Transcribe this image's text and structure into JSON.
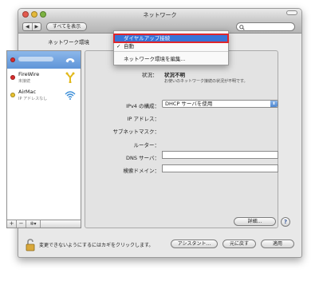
{
  "window": {
    "title": "ネットワーク"
  },
  "toolbar": {
    "back_label": "◀",
    "forward_label": "▶",
    "show_all_label": "すべてを表示",
    "search_placeholder": ""
  },
  "location": {
    "label": "ネットワーク環境"
  },
  "location_menu": {
    "items": [
      {
        "label": "ダイヤルアップ接続",
        "highlighted": true,
        "checked": false
      },
      {
        "label": "自動",
        "highlighted": false,
        "checked": true
      },
      {
        "label": "ネットワーク環境を編集...",
        "highlighted": false,
        "checked": false
      }
    ],
    "check_mark": "✓"
  },
  "sidebar": {
    "items": [
      {
        "name": "",
        "sub": "",
        "status_color": "#d92c2c",
        "icon": "phone-icon",
        "selected": true
      },
      {
        "name": "FireWire",
        "sub": "未接続",
        "status_color": "#d92c2c",
        "icon": "firewire-icon",
        "selected": false
      },
      {
        "name": "AirMac",
        "sub": "IP アドレスなし",
        "status_color": "#e9c22f",
        "icon": "wifi-icon",
        "selected": false
      }
    ],
    "add_label": "+",
    "remove_label": "−",
    "gear_label": "✲▾"
  },
  "detail": {
    "status_label": "状況：",
    "status_value": "状況不明",
    "status_desc": "お使いのネットワーク接続の状況が不明です。",
    "ipv4_label": "IPv4 の構成：",
    "ipv4_value": "DHCP サーバを使用",
    "ip_label": "IP アドレス：",
    "subnet_label": "サブネットマスク：",
    "router_label": "ルーター：",
    "dns_label": "DNS サーバ：",
    "search_domain_label": "検索ドメイン：",
    "advanced_label": "詳細...",
    "help_label": "?"
  },
  "footer": {
    "lock_text": "変更できないようにするにはカギをクリックします。",
    "assistant_label": "アシスタント...",
    "revert_label": "元に戻す",
    "apply_label": "適用"
  },
  "colors": {
    "highlight": "#3874d8",
    "annotation_box": "#e0262b"
  }
}
